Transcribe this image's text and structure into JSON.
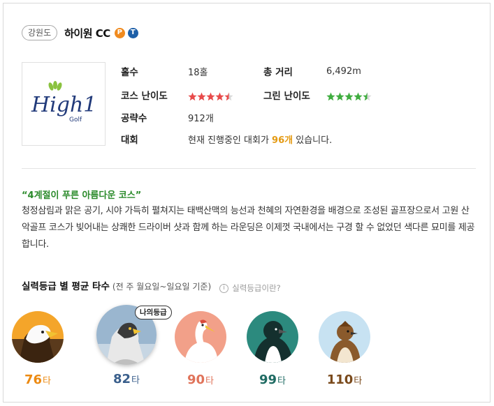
{
  "header": {
    "region": "강원도",
    "course_name": "하이원 CC",
    "badge_p": "P",
    "badge_t": "T"
  },
  "logo": {
    "text_main": "High1",
    "text_sub": "Golf"
  },
  "info": {
    "holes_label": "홀수",
    "holes_value": "18홀",
    "distance_label": "총 거리",
    "distance_value": "6,492m",
    "course_difficulty_label": "코스 난이도",
    "course_difficulty_rating": 4.5,
    "green_difficulty_label": "그린 난이도",
    "green_difficulty_rating": 4.5,
    "reviews_label": "공략수",
    "reviews_value": "912개",
    "tournament_label": "대회",
    "tournament_prefix": "현재 진행중인 대회가 ",
    "tournament_count": "96개",
    "tournament_suffix": " 있습니다."
  },
  "description": {
    "quote": "“4계절이 푸른 아름다운 코스”",
    "body": "청정삼림과 맑은 공기, 시야 가득히 펼쳐지는 태백산맥의 능선과 천혜의 자연환경을 배경으로 조성된 골프장으로서 고원 산악골프 코스가 빚어내는 상쾌한 드라이버 샷과 함께 하는 라운딩은 이제껏 국내에서는 구경 할 수 없었던 색다른 묘미를 제공합니다."
  },
  "grades": {
    "title": "실력등급 별 평균 타수",
    "subtitle": "(전 주 월요일~일요일 기준)",
    "help": "실력등급이란?",
    "my_grade_label": "나의등급",
    "unit": "타",
    "items": [
      {
        "score": "76",
        "color": "#ec8a12"
      },
      {
        "score": "82",
        "color": "#3a5f8c"
      },
      {
        "score": "90",
        "color": "#e0735a"
      },
      {
        "score": "99",
        "color": "#1f6b63"
      },
      {
        "score": "110",
        "color": "#7a4a1c"
      }
    ]
  },
  "colors": {
    "star_red": "#e84b4b",
    "star_green": "#3fad3f",
    "star_empty": "#d8d8d8",
    "highlight": "#e49a12",
    "quote_green": "#2a8a2a"
  }
}
